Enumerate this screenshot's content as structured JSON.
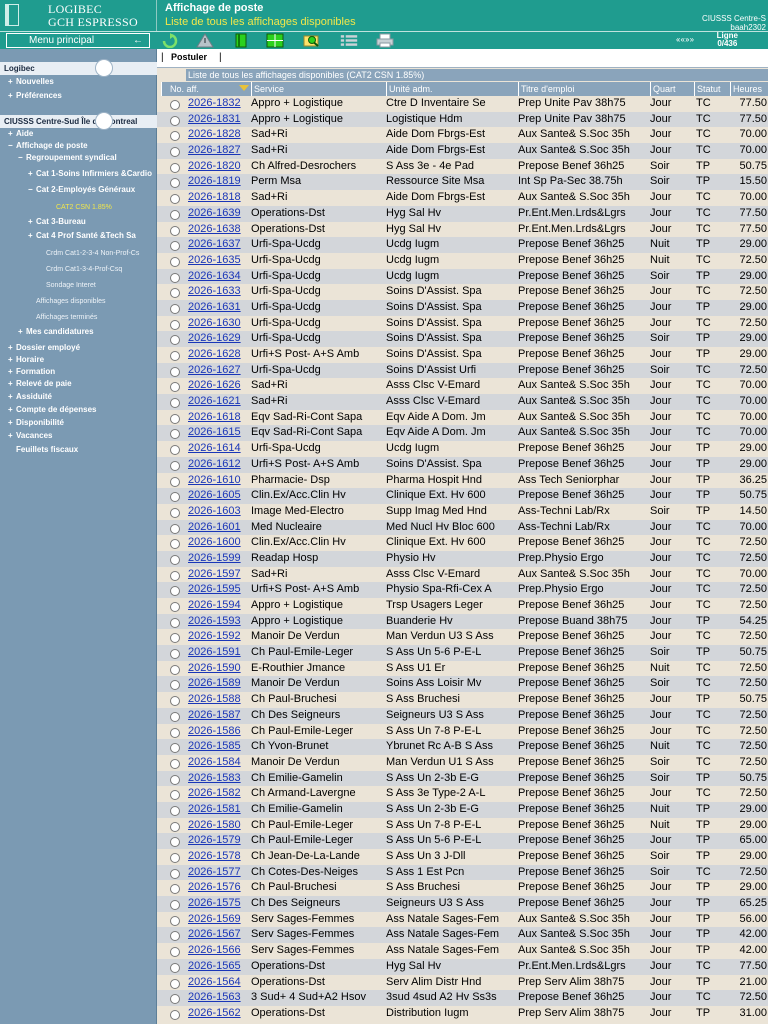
{
  "brand": {
    "line1": "LOGIBEC",
    "line2": "GCH ESPRESSO"
  },
  "header": {
    "title": "Affichage de poste",
    "subtitle": "Liste de tous les affichages disponibles",
    "org_line1": "CIUSSS Centre-S",
    "org_line2": "baah2302"
  },
  "toolbar": {
    "menu_label": "Menu principal",
    "menu_arrow": "←",
    "ligne_label": "Ligne",
    "ligne_value": "0/436",
    "nav_arrows": "‹‹ ‹‹ ›› ››"
  },
  "sidebar": {
    "section1": "Logibec",
    "section2": "CIUSSS Centre-Sud Île de Montreal",
    "items1": [
      "Nouvelles",
      "Préférences"
    ],
    "items2": [
      {
        "label": "Aide",
        "plus": "+",
        "cls": ""
      },
      {
        "label": "Affichage de poste",
        "plus": "−",
        "cls": ""
      },
      {
        "label": "Regroupement syndical",
        "plus": "−",
        "cls": "",
        "indent": 1
      },
      {
        "label": "Cat 1-Soins Infirmiers &Cardio",
        "plus": "+",
        "cls": "",
        "indent": 2
      },
      {
        "label": "Cat 2-Employés Généraux",
        "plus": "−",
        "cls": "",
        "indent": 2
      },
      {
        "label": "CAT2 CSN 1.85%",
        "plus": "",
        "cls": "active",
        "indent": 4
      },
      {
        "label": "Cat 3-Bureau",
        "plus": "+",
        "cls": "",
        "indent": 2
      },
      {
        "label": "Cat 4 Prof Santé &Tech Sa",
        "plus": "+",
        "cls": "",
        "indent": 2
      },
      {
        "label": "Crdm Cat1-2-3-4 Non-Prof-Cs",
        "plus": "",
        "cls": "sub",
        "indent": 3
      },
      {
        "label": "Crdm Cat1-3-4-Prof-Csq",
        "plus": "",
        "cls": "sub",
        "indent": 3
      },
      {
        "label": "Sondage Interet",
        "plus": "",
        "cls": "sub",
        "indent": 3
      },
      {
        "label": "Affichages disponibles",
        "plus": "",
        "cls": "sub",
        "indent": 2
      },
      {
        "label": "Affichages terminés",
        "plus": "",
        "cls": "sub",
        "indent": 2
      },
      {
        "label": "Mes candidatures",
        "plus": "+",
        "cls": "",
        "indent": 1
      },
      {
        "label": "Dossier employé",
        "plus": "+",
        "cls": ""
      },
      {
        "label": "Horaire",
        "plus": "+",
        "cls": ""
      },
      {
        "label": "Formation",
        "plus": "+",
        "cls": ""
      },
      {
        "label": "Relevé de paie",
        "plus": "+",
        "cls": ""
      },
      {
        "label": "Assiduité",
        "plus": "+",
        "cls": ""
      },
      {
        "label": "Compte de dépenses",
        "plus": "+",
        "cls": ""
      },
      {
        "label": "Disponibilité",
        "plus": "+",
        "cls": ""
      },
      {
        "label": "Vacances",
        "plus": "+",
        "cls": ""
      },
      {
        "label": "Feuillets fiscaux",
        "plus": "",
        "cls": ""
      }
    ]
  },
  "main": {
    "postuler_label": "Postuler",
    "caption": "Liste de tous les affichages disponibles (CAT2 CSN 1.85%)",
    "columns": [
      "No. aff.",
      "Service",
      "Unité adm.",
      "Titre d'emploi",
      "Quart",
      "Statut",
      "Heures"
    ],
    "rows": [
      [
        "2026-1832",
        "Appro + Logistique",
        "Ctre D Inventaire Se",
        "Prep Unite Pav 38h75",
        "Jour",
        "TC",
        "77.50"
      ],
      [
        "2026-1831",
        "Appro + Logistique",
        "Logistique Hdm",
        "Prep Unite Pav 38h75",
        "Jour",
        "TC",
        "77.50"
      ],
      [
        "2026-1828",
        "Sad+Ri",
        "Aide Dom Fbrgs-Est",
        "Aux Sante& S.Soc 35h",
        "Jour",
        "TC",
        "70.00"
      ],
      [
        "2026-1827",
        "Sad+Ri",
        "Aide Dom Fbrgs-Est",
        "Aux Sante& S.Soc 35h",
        "Jour",
        "TC",
        "70.00"
      ],
      [
        "2026-1820",
        "Ch Alfred-Desrochers",
        "S Ass 3e - 4e Pad",
        "Prepose Benef 36h25",
        "Soir",
        "TP",
        "50.75"
      ],
      [
        "2026-1819",
        "Perm Msa",
        "Ressource Site Msa",
        "Int Sp Pa-Sec 38.75h",
        "Soir",
        "TP",
        "15.50"
      ],
      [
        "2026-1818",
        "Sad+Ri",
        "Aide Dom Fbrgs-Est",
        "Aux Sante& S.Soc 35h",
        "Jour",
        "TC",
        "70.00"
      ],
      [
        "2026-1639",
        "Operations-Dst",
        "Hyg Sal Hv",
        "Pr.Ent.Men.Lrds&Lgrs",
        "Jour",
        "TC",
        "77.50"
      ],
      [
        "2026-1638",
        "Operations-Dst",
        "Hyg Sal Hv",
        "Pr.Ent.Men.Lrds&Lgrs",
        "Jour",
        "TC",
        "77.50"
      ],
      [
        "2026-1637",
        "Urfi-Spa-Ucdg",
        "Ucdg Iugm",
        "Prepose Benef 36h25",
        "Nuit",
        "TP",
        "29.00"
      ],
      [
        "2026-1635",
        "Urfi-Spa-Ucdg",
        "Ucdg Iugm",
        "Prepose Benef 36h25",
        "Nuit",
        "TC",
        "72.50"
      ],
      [
        "2026-1634",
        "Urfi-Spa-Ucdg",
        "Ucdg Iugm",
        "Prepose Benef 36h25",
        "Soir",
        "TP",
        "29.00"
      ],
      [
        "2026-1633",
        "Urfi-Spa-Ucdg",
        "Soins D'Assist. Spa",
        "Prepose Benef 36h25",
        "Jour",
        "TC",
        "72.50"
      ],
      [
        "2026-1631",
        "Urfi-Spa-Ucdg",
        "Soins D'Assist. Spa",
        "Prepose Benef 36h25",
        "Jour",
        "TP",
        "29.00"
      ],
      [
        "2026-1630",
        "Urfi-Spa-Ucdg",
        "Soins D'Assist. Spa",
        "Prepose Benef 36h25",
        "Jour",
        "TC",
        "72.50"
      ],
      [
        "2026-1629",
        "Urfi-Spa-Ucdg",
        "Soins D'Assist. Spa",
        "Prepose Benef 36h25",
        "Soir",
        "TP",
        "29.00"
      ],
      [
        "2026-1628",
        "Urfi+S Post- A+S Amb",
        "Soins D'Assist. Spa",
        "Prepose Benef 36h25",
        "Jour",
        "TP",
        "29.00"
      ],
      [
        "2026-1627",
        "Urfi-Spa-Ucdg",
        "Soins D'Assist Urfi",
        "Prepose Benef 36h25",
        "Soir",
        "TC",
        "72.50"
      ],
      [
        "2026-1626",
        "Sad+Ri",
        "Asss Clsc V-Emard",
        "Aux Sante& S.Soc 35h",
        "Jour",
        "TC",
        "70.00"
      ],
      [
        "2026-1621",
        "Sad+Ri",
        "Asss Clsc V-Emard",
        "Aux Sante& S.Soc 35h",
        "Jour",
        "TC",
        "70.00"
      ],
      [
        "2026-1618",
        "Eqv Sad-Ri-Cont Sapa",
        "Eqv Aide A Dom. Jm",
        "Aux Sante& S.Soc 35h",
        "Jour",
        "TC",
        "70.00"
      ],
      [
        "2026-1615",
        "Eqv Sad-Ri-Cont Sapa",
        "Eqv Aide A Dom. Jm",
        "Aux Sante& S.Soc 35h",
        "Jour",
        "TC",
        "70.00"
      ],
      [
        "2026-1614",
        "Urfi-Spa-Ucdg",
        "Ucdg Iugm",
        "Prepose Benef 36h25",
        "Jour",
        "TP",
        "29.00"
      ],
      [
        "2026-1612",
        "Urfi+S Post- A+S Amb",
        "Soins D'Assist. Spa",
        "Prepose Benef 36h25",
        "Jour",
        "TP",
        "29.00"
      ],
      [
        "2026-1610",
        "Pharmacie- Dsp",
        "Pharma Hospit Hnd",
        "Ass Tech Seniorphar",
        "Jour",
        "TP",
        "36.25"
      ],
      [
        "2026-1605",
        "Clin.Ex/Acc.Clin Hv",
        "Clinique Ext. Hv 600",
        "Prepose Benef 36h25",
        "Jour",
        "TP",
        "50.75"
      ],
      [
        "2026-1603",
        "Image Med-Electro",
        "Supp Imag Med Hnd",
        "Ass-Techni Lab/Rx",
        "Soir",
        "TP",
        "14.50"
      ],
      [
        "2026-1601",
        "Med Nucleaire",
        "Med Nucl Hv Bloc 600",
        "Ass-Techni Lab/Rx",
        "Jour",
        "TC",
        "70.00"
      ],
      [
        "2026-1600",
        "Clin.Ex/Acc.Clin Hv",
        "Clinique Ext. Hv 600",
        "Prepose Benef 36h25",
        "Jour",
        "TC",
        "72.50"
      ],
      [
        "2026-1599",
        "Readap Hosp",
        "Physio Hv",
        "Prep.Physio Ergo",
        "Jour",
        "TC",
        "72.50"
      ],
      [
        "2026-1597",
        "Sad+Ri",
        "Asss Clsc V-Emard",
        "Aux Sante& S.Soc 35h",
        "Jour",
        "TC",
        "70.00"
      ],
      [
        "2026-1595",
        "Urfi+S Post- A+S Amb",
        "Physio Spa-Rfi-Cex A",
        "Prep.Physio Ergo",
        "Jour",
        "TC",
        "72.50"
      ],
      [
        "2026-1594",
        "Appro + Logistique",
        "Trsp Usagers Leger",
        "Prepose Benef 36h25",
        "Jour",
        "TC",
        "72.50"
      ],
      [
        "2026-1593",
        "Appro + Logistique",
        "Buanderie Hv",
        "Prepose Buand 38h75",
        "Jour",
        "TP",
        "54.25"
      ],
      [
        "2026-1592",
        "Manoir De Verdun",
        "Man Verdun U3 S Ass",
        "Prepose Benef 36h25",
        "Jour",
        "TC",
        "72.50"
      ],
      [
        "2026-1591",
        "Ch Paul-Emile-Leger",
        "S Ass Un 5-6 P-E-L",
        "Prepose Benef 36h25",
        "Soir",
        "TP",
        "50.75"
      ],
      [
        "2026-1590",
        "E-Routhier Jmance",
        "S Ass U1 Er",
        "Prepose Benef 36h25",
        "Nuit",
        "TC",
        "72.50"
      ],
      [
        "2026-1589",
        "Manoir De Verdun",
        "Soins Ass Loisir Mv",
        "Prepose Benef 36h25",
        "Soir",
        "TC",
        "72.50"
      ],
      [
        "2026-1588",
        "Ch Paul-Bruchesi",
        "S Ass Bruchesi",
        "Prepose Benef 36h25",
        "Jour",
        "TP",
        "50.75"
      ],
      [
        "2026-1587",
        "Ch Des Seigneurs",
        "Seigneurs U3 S Ass",
        "Prepose Benef 36h25",
        "Jour",
        "TC",
        "72.50"
      ],
      [
        "2026-1586",
        "Ch Paul-Emile-Leger",
        "S Ass Un 7-8 P-E-L",
        "Prepose Benef 36h25",
        "Jour",
        "TC",
        "72.50"
      ],
      [
        "2026-1585",
        "Ch Yvon-Brunet",
        "Ybrunet Rc A-B S Ass",
        "Prepose Benef 36h25",
        "Nuit",
        "TC",
        "72.50"
      ],
      [
        "2026-1584",
        "Manoir De Verdun",
        "Man Verdun U1 S Ass",
        "Prepose Benef 36h25",
        "Soir",
        "TC",
        "72.50"
      ],
      [
        "2026-1583",
        "Ch Emilie-Gamelin",
        "S Ass Un 2-3b E-G",
        "Prepose Benef 36h25",
        "Soir",
        "TP",
        "50.75"
      ],
      [
        "2026-1582",
        "Ch Armand-Lavergne",
        "S Ass 3e Type-2 A-L",
        "Prepose Benef 36h25",
        "Jour",
        "TC",
        "72.50"
      ],
      [
        "2026-1581",
        "Ch Emilie-Gamelin",
        "S Ass Un 2-3b E-G",
        "Prepose Benef 36h25",
        "Nuit",
        "TP",
        "29.00"
      ],
      [
        "2026-1580",
        "Ch Paul-Emile-Leger",
        "S Ass Un 7-8 P-E-L",
        "Prepose Benef 36h25",
        "Nuit",
        "TP",
        "29.00"
      ],
      [
        "2026-1579",
        "Ch Paul-Emile-Leger",
        "S Ass Un 5-6 P-E-L",
        "Prepose Benef 36h25",
        "Jour",
        "TP",
        "65.00"
      ],
      [
        "2026-1578",
        "Ch Jean-De-La-Lande",
        "S Ass Un 3 J-Dll",
        "Prepose Benef 36h25",
        "Soir",
        "TP",
        "29.00"
      ],
      [
        "2026-1577",
        "Ch Cotes-Des-Neiges",
        "S Ass 1 Est Pcn",
        "Prepose Benef 36h25",
        "Soir",
        "TC",
        "72.50"
      ],
      [
        "2026-1576",
        "Ch Paul-Bruchesi",
        "S Ass Bruchesi",
        "Prepose Benef 36h25",
        "Jour",
        "TP",
        "29.00"
      ],
      [
        "2026-1575",
        "Ch Des Seigneurs",
        "Seigneurs U3 S Ass",
        "Prepose Benef 36h25",
        "Jour",
        "TP",
        "65.25"
      ],
      [
        "2026-1569",
        "Serv Sages-Femmes",
        "Ass Natale Sages-Fem",
        "Aux Sante& S.Soc 35h",
        "Jour",
        "TP",
        "56.00"
      ],
      [
        "2026-1567",
        "Serv Sages-Femmes",
        "Ass Natale Sages-Fem",
        "Aux Sante& S.Soc 35h",
        "Jour",
        "TP",
        "42.00"
      ],
      [
        "2026-1566",
        "Serv Sages-Femmes",
        "Ass Natale Sages-Fem",
        "Aux Sante& S.Soc 35h",
        "Jour",
        "TP",
        "42.00"
      ],
      [
        "2026-1565",
        "Operations-Dst",
        "Hyg Sal Hv",
        "Pr.Ent.Men.Lrds&Lgrs",
        "Jour",
        "TC",
        "77.50"
      ],
      [
        "2026-1564",
        "Operations-Dst",
        "Serv Alim Distr Hnd",
        "Prep Serv Alim 38h75",
        "Jour",
        "TP",
        "21.00"
      ],
      [
        "2026-1563",
        "3 Sud+ 4 Sud+A2 Hsov",
        "3sud 4sud A2 Hv Ss3s",
        "Prepose Benef 36h25",
        "Jour",
        "TC",
        "72.50"
      ],
      [
        "2026-1562",
        "Operations-Dst",
        "Distribution Iugm",
        "Prep Serv Alim 38h75",
        "Jour",
        "TP",
        "31.00"
      ]
    ]
  }
}
